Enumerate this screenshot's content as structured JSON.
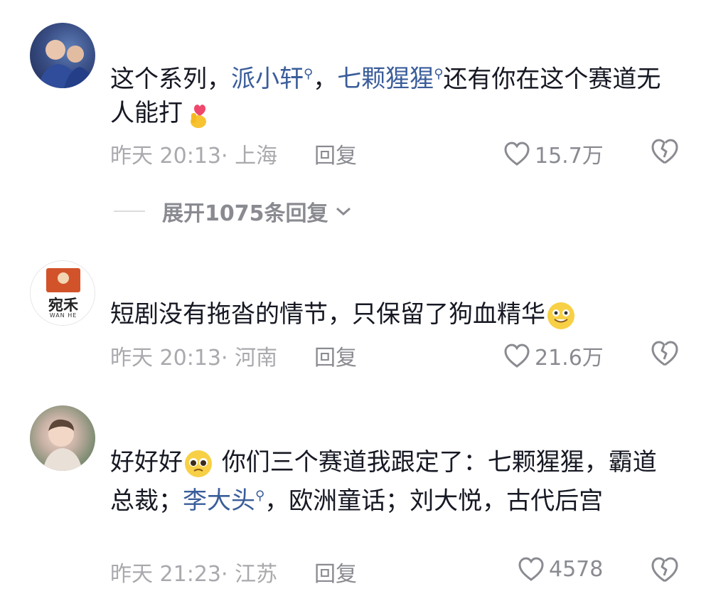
{
  "comments": [
    {
      "text_parts": [
        "这个系列，",
        "派小轩",
        "，",
        "七颗猩猩",
        "还有你在这个赛道无人能打"
      ],
      "time": "昨天 20:13",
      "location": "上海",
      "reply_label": "回复",
      "likes": "15.7万"
    },
    {
      "text_parts": [
        "短剧没有拖沓的情节，只保留了狗血精华"
      ],
      "time": "昨天 20:13",
      "location": "河南",
      "reply_label": "回复",
      "likes": "21.6万",
      "avatar_brand_cn": "宛禾",
      "avatar_brand_en": "WAN HE"
    },
    {
      "text_parts": [
        "好好好",
        "你们三个赛道我跟定了：七颗猩猩，霸道总裁；",
        "李大头",
        "，欧洲童话；刘大悦，古代后宫"
      ],
      "time": "昨天 21:23",
      "location": "江苏",
      "reply_label": "回复",
      "likes": "4578"
    }
  ],
  "expand_replies": "展开1075条回复",
  "icons": {
    "like": "heart-outline-icon",
    "dislike": "broken-heart-icon",
    "expand": "chevron-down-icon",
    "mention": "search-icon"
  },
  "colors": {
    "mention": "#3a5d9a",
    "meta": "#a9a9ae",
    "text": "#161823"
  }
}
